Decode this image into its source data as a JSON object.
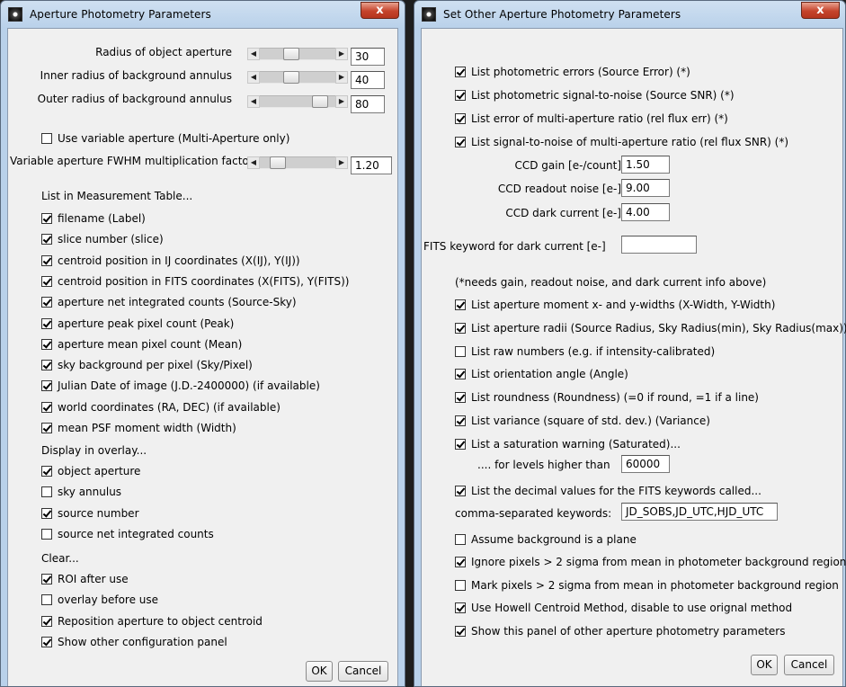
{
  "left": {
    "title": "Aperture Photometry Parameters",
    "close": "x",
    "sliders": [
      {
        "label": "Radius of object aperture",
        "value": "30"
      },
      {
        "label": "Inner radius of background annulus",
        "value": "40"
      },
      {
        "label": "Outer radius of background annulus",
        "value": "80"
      }
    ],
    "variable_aperture": {
      "label": "Use variable aperture (Multi-Aperture only)",
      "checked": false
    },
    "fwhm": {
      "label": "Variable aperture FWHM multiplication factor",
      "value": "1.20"
    },
    "list_header": "List in Measurement Table...",
    "list_items": [
      {
        "label": "filename (Label)",
        "checked": true
      },
      {
        "label": "slice number (slice)",
        "checked": true
      },
      {
        "label": "centroid position in IJ coordinates (X(IJ), Y(IJ))",
        "checked": true
      },
      {
        "label": "centroid position in FITS coordinates (X(FITS), Y(FITS))",
        "checked": true
      },
      {
        "label": "aperture net integrated counts (Source-Sky)",
        "checked": true
      },
      {
        "label": "aperture peak pixel count (Peak)",
        "checked": true
      },
      {
        "label": "aperture mean pixel count (Mean)",
        "checked": true
      },
      {
        "label": "sky background per pixel (Sky/Pixel)",
        "checked": true
      },
      {
        "label": "Julian Date of image (J.D.-2400000) (if available)",
        "checked": true
      },
      {
        "label": "world coordinates (RA, DEC) (if available)",
        "checked": true
      },
      {
        "label": "mean PSF moment width (Width)",
        "checked": true
      }
    ],
    "overlay_header": "Display in overlay...",
    "overlay_items": [
      {
        "label": "object aperture",
        "checked": true
      },
      {
        "label": "sky annulus",
        "checked": false
      },
      {
        "label": "source number",
        "checked": true
      },
      {
        "label": "source net integrated counts",
        "checked": false
      }
    ],
    "clear_header": "Clear...",
    "clear_items": [
      {
        "label": "ROI after use",
        "checked": true
      },
      {
        "label": "overlay before use",
        "checked": false
      },
      {
        "label": "Reposition aperture to object centroid",
        "checked": true
      },
      {
        "label": "Show other configuration panel",
        "checked": true
      }
    ],
    "ok": "OK",
    "cancel": "Cancel"
  },
  "right": {
    "title": "Set Other Aperture Photometry Parameters",
    "close": "x",
    "top_items": [
      {
        "label": "List photometric errors (Source Error) (*)",
        "checked": true
      },
      {
        "label": "List photometric signal-to-noise (Source SNR) (*)",
        "checked": true
      },
      {
        "label": "List error of multi-aperture ratio (rel flux err) (*)",
        "checked": true
      },
      {
        "label": "List signal-to-noise of multi-aperture ratio (rel flux SNR) (*)",
        "checked": true
      }
    ],
    "fields": [
      {
        "label": "CCD gain [e-/count]",
        "value": "1.50"
      },
      {
        "label": "CCD readout noise [e-]",
        "value": "9.00"
      },
      {
        "label": "CCD dark current [e-]",
        "value": "4.00"
      }
    ],
    "dark_keyword": {
      "label": "FITS keyword for dark current [e-]",
      "value": ""
    },
    "needs_note": "(*needs gain, readout noise, and dark current info above)",
    "mid_items": [
      {
        "label": "List aperture moment x- and y-widths (X-Width, Y-Width)",
        "checked": true
      },
      {
        "label": "List aperture radii (Source Radius, Sky Radius(min), Sky Radius(max))",
        "checked": true
      },
      {
        "label": "List raw numbers (e.g. if intensity-calibrated)",
        "checked": false
      },
      {
        "label": "List orientation angle (Angle)",
        "checked": true
      },
      {
        "label": "List roundness (Roundness) (=0 if round, =1 if a line)",
        "checked": true
      },
      {
        "label": "List variance (square of std. dev.) (Variance)",
        "checked": true
      },
      {
        "label": "List a saturation warning (Saturated)...",
        "checked": true
      }
    ],
    "saturation": {
      "label": ".... for levels higher than",
      "value": "60000"
    },
    "decimal_item": {
      "label": "List the decimal values for the FITS keywords called...",
      "checked": true
    },
    "keywords": {
      "label": "comma-separated keywords:",
      "value": "JD_SOBS,JD_UTC,HJD_UTC"
    },
    "bottom_items": [
      {
        "label": "Assume background is a plane",
        "checked": false
      },
      {
        "label": "Ignore pixels > 2 sigma from mean in photometer background region",
        "checked": true
      },
      {
        "label": "Mark pixels > 2 sigma from mean in photometer background region",
        "checked": false
      },
      {
        "label": "Use Howell Centroid Method, disable to use orignal method",
        "checked": true
      },
      {
        "label": "Show this panel of other aperture photometry parameters",
        "checked": true
      }
    ],
    "ok": "OK",
    "cancel": "Cancel"
  }
}
